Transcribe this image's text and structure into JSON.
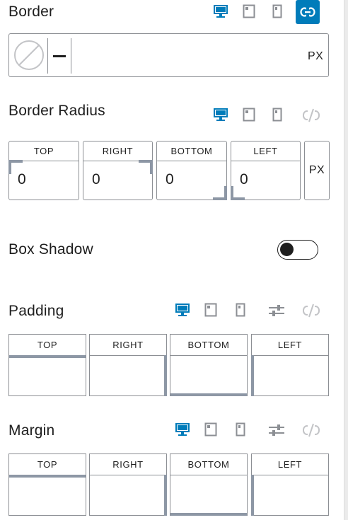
{
  "border": {
    "title": "Border",
    "unit": "PX",
    "styles": [
      "none",
      "solid"
    ],
    "linked": true
  },
  "border_radius": {
    "title": "Border Radius",
    "unit": "PX",
    "fields": [
      {
        "label": "TOP",
        "value": "0"
      },
      {
        "label": "RIGHT",
        "value": "0"
      },
      {
        "label": "BOTTOM",
        "value": "0"
      },
      {
        "label": "LEFT",
        "value": "0"
      }
    ]
  },
  "box_shadow": {
    "title": "Box Shadow",
    "enabled": false
  },
  "padding": {
    "title": "Padding",
    "fields": [
      {
        "label": "TOP",
        "value": ""
      },
      {
        "label": "RIGHT",
        "value": ""
      },
      {
        "label": "BOTTOM",
        "value": ""
      },
      {
        "label": "LEFT",
        "value": ""
      }
    ]
  },
  "margin": {
    "title": "Margin",
    "fields": [
      {
        "label": "TOP",
        "value": ""
      },
      {
        "label": "RIGHT",
        "value": ""
      },
      {
        "label": "BOTTOM",
        "value": ""
      },
      {
        "label": "LEFT",
        "value": ""
      }
    ]
  },
  "icons": {
    "desktop": "desktop-icon",
    "tablet": "tablet-icon",
    "mobile": "mobile-icon",
    "link": "link-icon",
    "unlink": "unlink-icon",
    "settings": "sliders-icon"
  },
  "colors": {
    "accent": "#007cba",
    "inactive_icon": "#8c8f94",
    "side_marker": "#8d97a5",
    "text": "#1e1e1e",
    "border": "#8c8f94"
  }
}
